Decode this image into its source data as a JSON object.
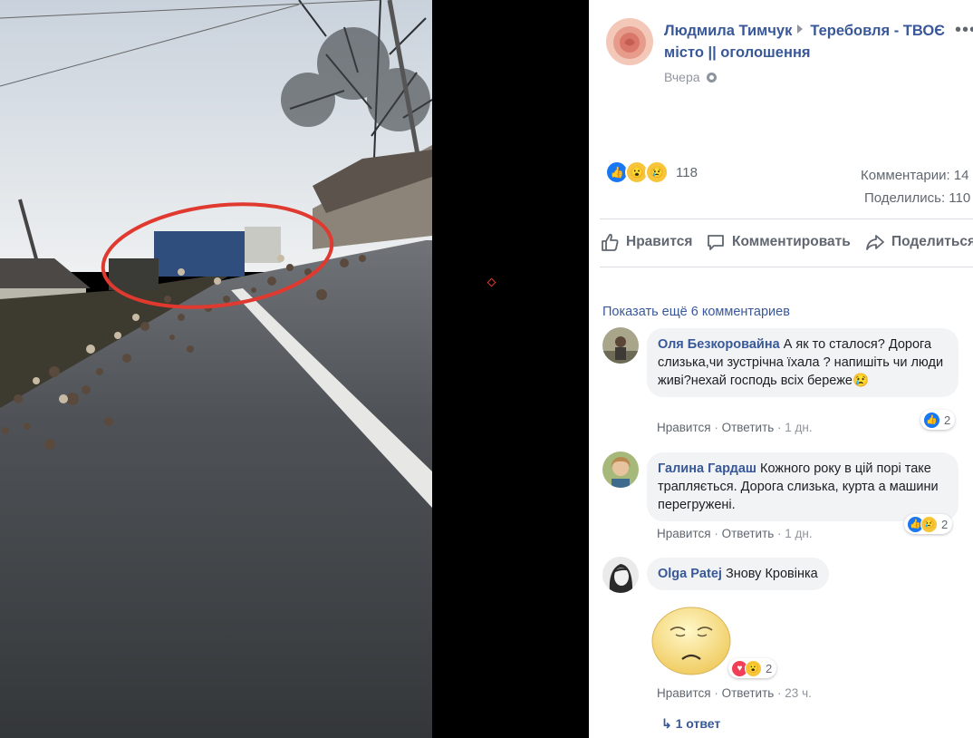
{
  "post": {
    "author": "Людмила Тимчук",
    "group": "Теребовля - ТВОЄ місто || оголошення",
    "time": "Вчера",
    "reaction_count": "118",
    "comments_label": "Комментарии: 14",
    "shares_label": "Поделились: 110"
  },
  "actions": {
    "like": "Нравится",
    "comment": "Комментировать",
    "share": "Поделиться"
  },
  "comments_section": {
    "show_more": "Показать ещё 6 комментариев"
  },
  "comments": [
    {
      "author": "Оля Безкоровайна",
      "text": "А як то сталося? Дорога слизька,чи зустрічна їхала ? напишіть чи люди живі?нехай господь всіх береже😢",
      "like": "Нравится",
      "reply": "Ответить",
      "time": "1 дн.",
      "reactions": "2"
    },
    {
      "author": "Галина Гардаш",
      "text": "Кожного року в цій порі таке трапляється. Дорога слизька, курта а машини перегружені.",
      "like": "Нравится",
      "reply": "Ответить",
      "time": "1 дн.",
      "reactions": "2"
    },
    {
      "author": "Olga Patej",
      "text": "Знову Кровінка",
      "like": "Нравится",
      "reply": "Ответить",
      "time": "23 ч.",
      "reactions": "2"
    }
  ],
  "replies_link": "1 ответ",
  "colors": {
    "link": "#385898",
    "muted": "#606770",
    "bubble": "#f2f3f5",
    "like_blue": "#1877f2",
    "circle_red": "#e0392f"
  },
  "icons": [
    "globe-icon",
    "like-icon",
    "comment-icon",
    "share-icon",
    "reply-arrow-icon",
    "more-icon"
  ]
}
